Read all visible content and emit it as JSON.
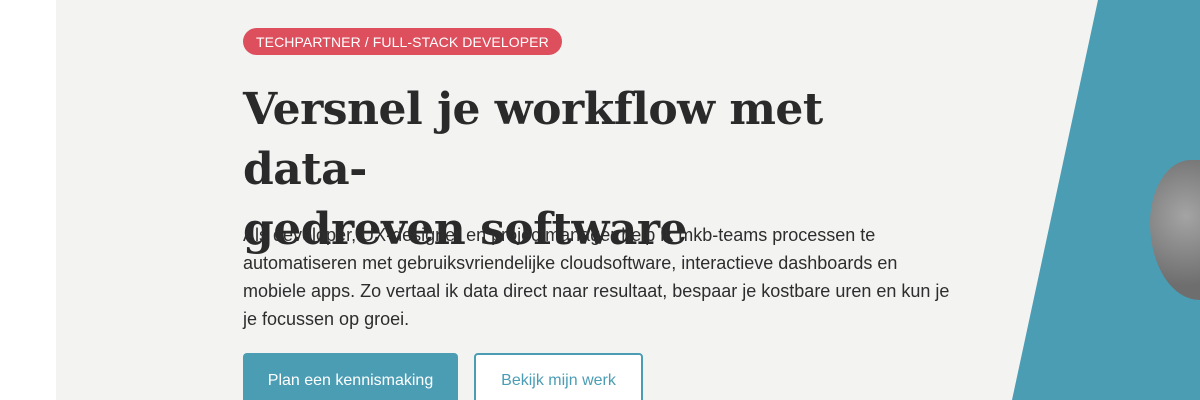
{
  "hero": {
    "badge": "TECHPARTNER / FULL-STACK DEVELOPER",
    "headline_line1": "Versnel je workflow met data-",
    "headline_line2": "gedreven software",
    "intro": "Als developer, UX-designer en projectmanager help ik mkb-teams processen te automatiseren met gebruiksvriendelijke cloudsoftware, interactieve dashboards en mobiele apps. Zo vertaal ik data direct naar resultaat, bespaar je kostbare uren en kun je je focussen op groei.",
    "primary_button": "Plan een kennismaking",
    "secondary_button": "Bekijk mijn werk"
  },
  "colors": {
    "accent_teal": "#4b9db4",
    "badge_red": "#dd4f5d",
    "panel_bg": "#f3f3f2",
    "heading": "#2a2a2a"
  }
}
